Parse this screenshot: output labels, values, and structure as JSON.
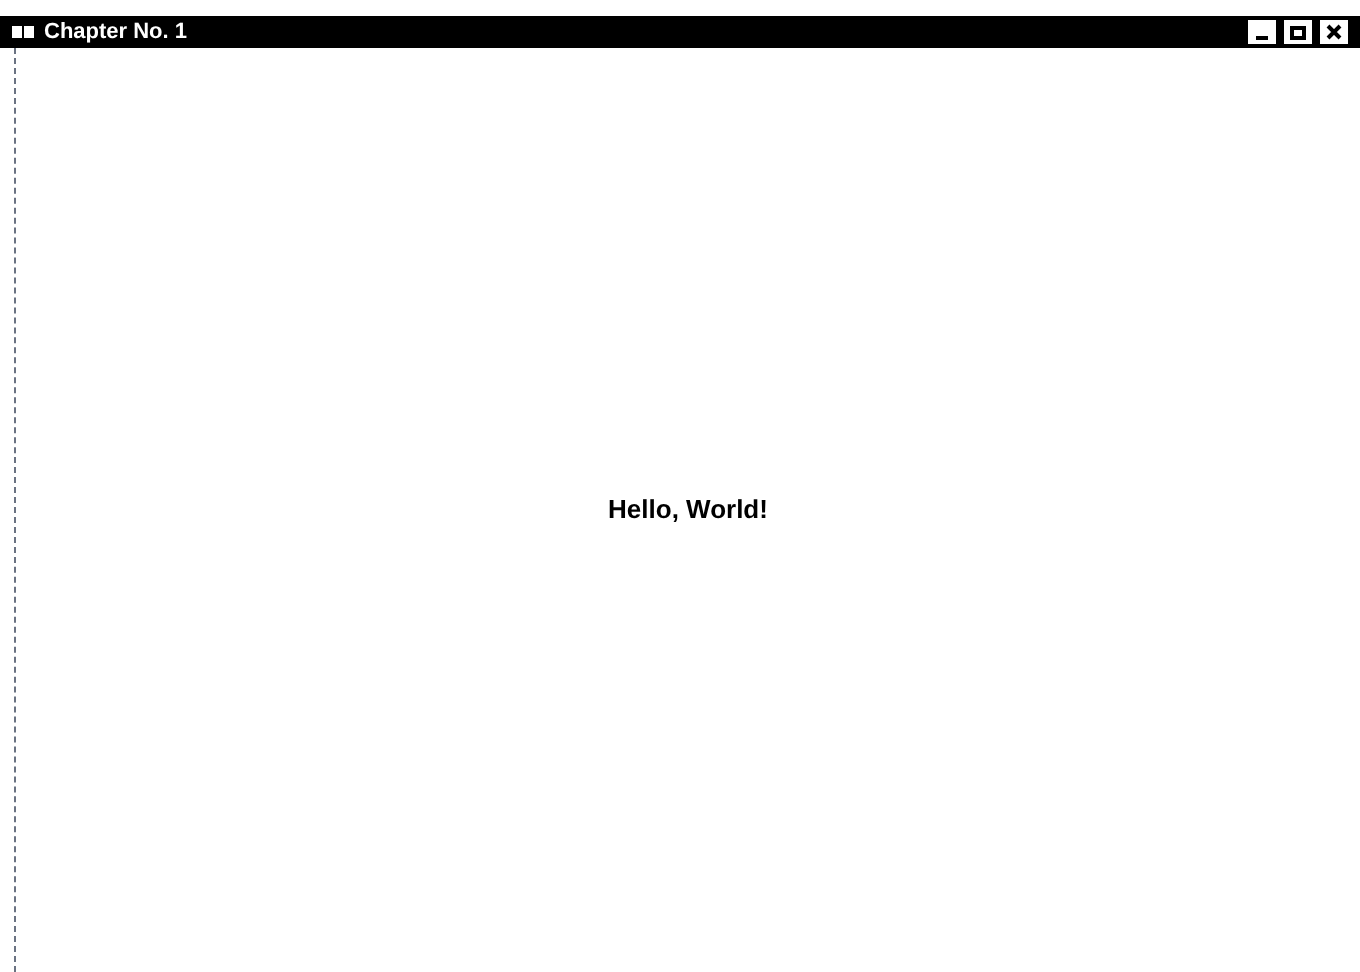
{
  "window": {
    "title": "Chapter No. 1"
  },
  "content": {
    "text": "Hello, World!"
  }
}
